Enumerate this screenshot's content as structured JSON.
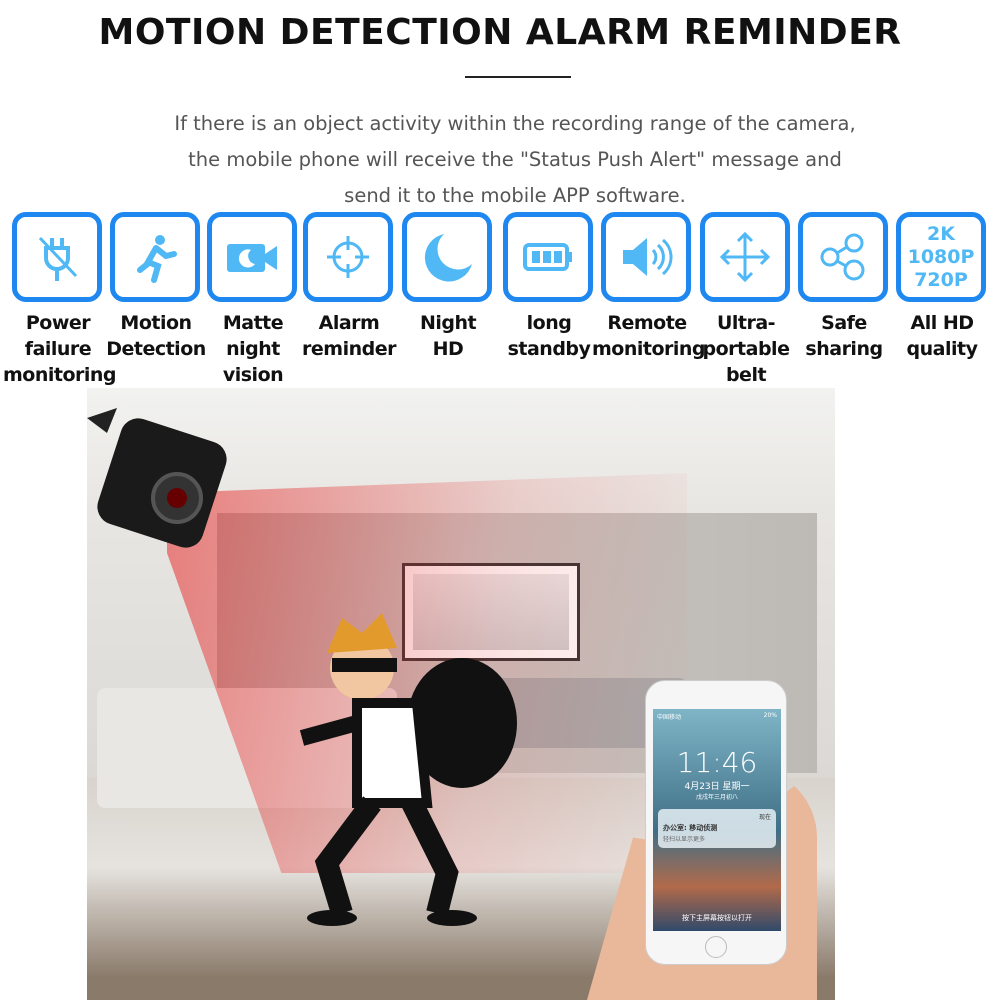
{
  "header": {
    "title": "MOTION DETECTION ALARM REMINDER",
    "description_lines": [
      "If there is an object activity within the recording range of the camera,",
      "the mobile phone will receive the \"Status Push Alert\" message and",
      "send it to the mobile APP software."
    ]
  },
  "accent_color": "#1e88f0",
  "icon_color": "#4fb8f5",
  "features": [
    {
      "icon": "unplugged-icon",
      "label": [
        "Power",
        "failure",
        "monitoring"
      ]
    },
    {
      "icon": "running-person-icon",
      "label": [
        "Motion",
        "Detection"
      ]
    },
    {
      "icon": "night-camera-icon",
      "label": [
        "Matte",
        "night",
        "vision"
      ]
    },
    {
      "icon": "crosshair-icon",
      "label": [
        "Alarm",
        "reminder"
      ]
    },
    {
      "icon": "moon-icon",
      "label": [
        "Night",
        "HD"
      ]
    },
    {
      "icon": "battery-icon",
      "label": [
        "long",
        "standby"
      ]
    },
    {
      "icon": "speaker-icon",
      "label": [
        "Remote",
        "monitoring"
      ]
    },
    {
      "icon": "move-arrows-icon",
      "label": [
        "Ultra-portable",
        "belt"
      ]
    },
    {
      "icon": "share-icon",
      "label": [
        "Safe",
        "sharing"
      ]
    },
    {
      "icon": "resolution-icon",
      "resolutions": [
        "2K",
        "1080P",
        "720P"
      ],
      "label": [
        "All HD",
        "quality"
      ]
    }
  ],
  "phone": {
    "carrier": "中国移动",
    "battery": "20%",
    "time": "11:46",
    "date": "4月23日 星期一",
    "lunar": "戊戌年三月初八",
    "notification": {
      "tag": "现在",
      "title": "办公室: 移动侦测",
      "body": "轻扫以显示更多"
    },
    "unlock_hint": "按下主屏幕按钮以打开"
  }
}
